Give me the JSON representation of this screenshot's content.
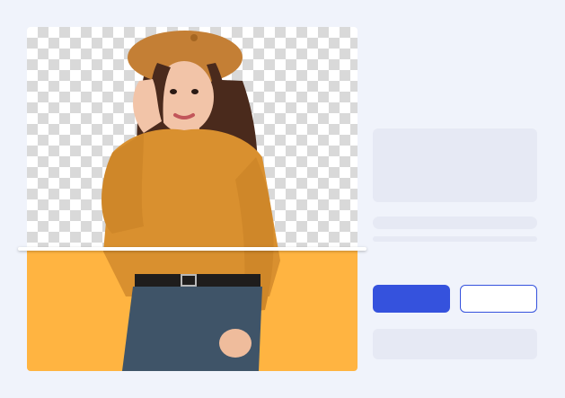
{
  "colors": {
    "page_background": "#f0f3fb",
    "checker_light": "#ffffff",
    "checker_dark": "#d9d9d9",
    "photo_background": "#ffb441",
    "skeleton": "#e6e9f4",
    "accent": "#3552dd",
    "sweater": "#d9902f",
    "jeans": "#3f5468",
    "hair": "#4a2a1c",
    "skin": "#f2c4a8"
  },
  "icons": {
    "subject": "person-photo-icon"
  },
  "actions": {
    "primary_label": "",
    "secondary_label": ""
  }
}
